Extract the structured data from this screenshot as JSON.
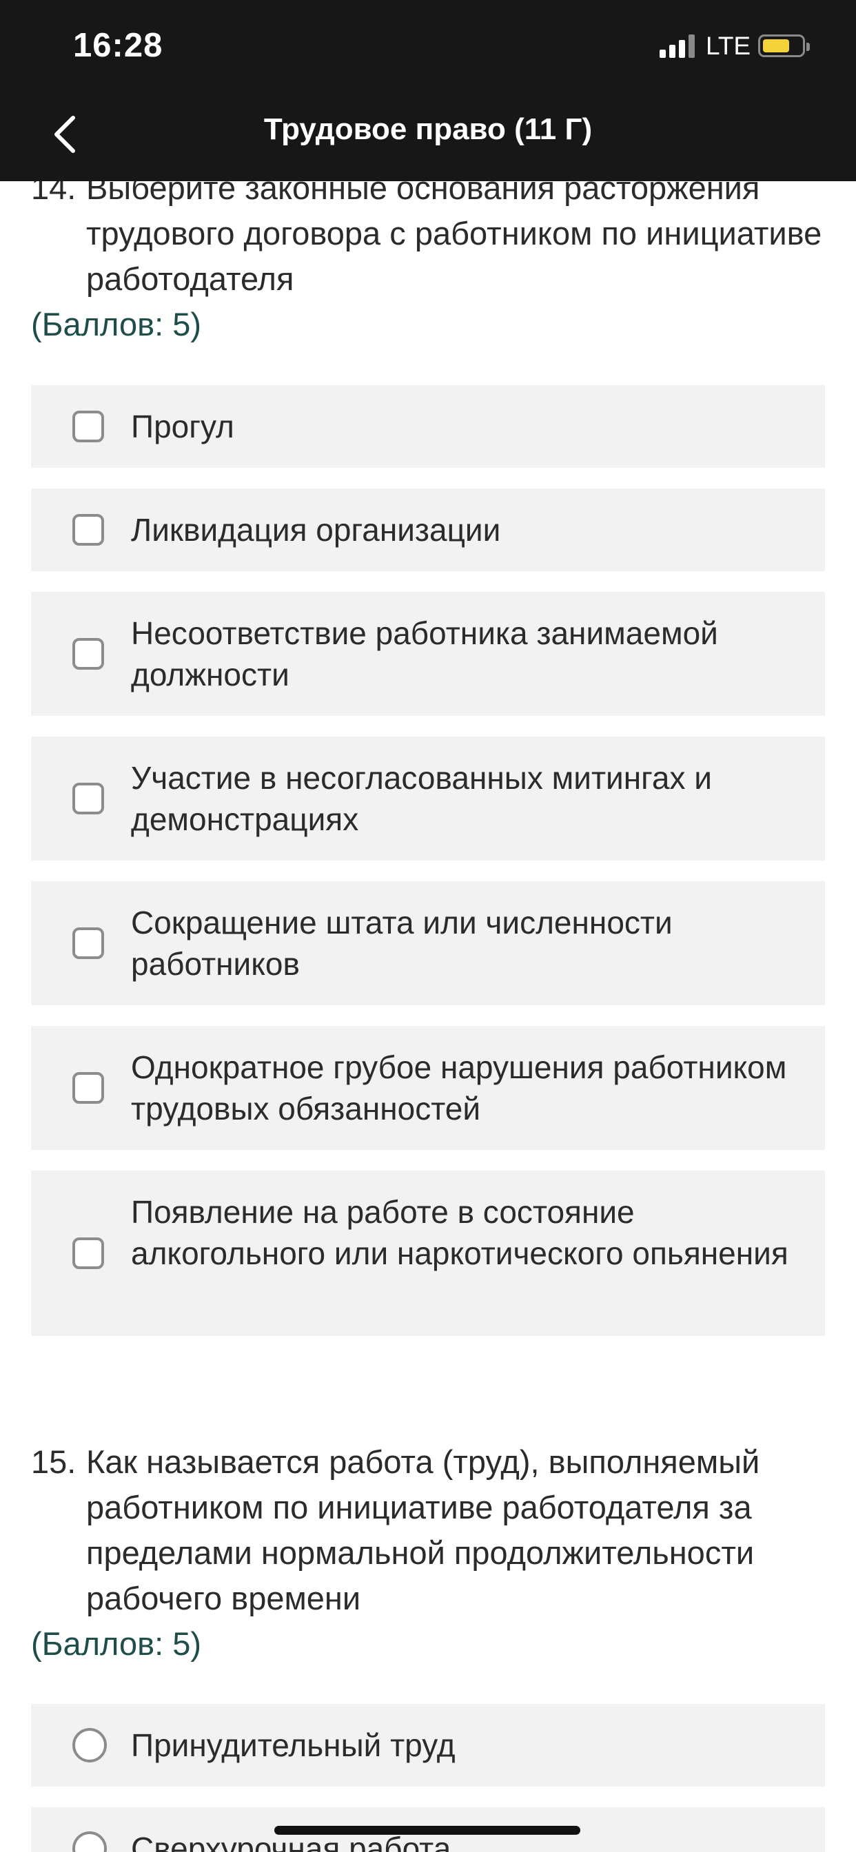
{
  "status_bar": {
    "time": "16:28",
    "network": "LTE",
    "battery_level": 0.6,
    "battery_color": "#f4d33a"
  },
  "nav": {
    "back_icon": "chevron-left-icon",
    "title": "Трудовое право (11  Г)"
  },
  "questions": [
    {
      "number": "14.",
      "text": "Выберите законные основания расторжения трудового договора с работником по инициативе работодателя",
      "points": "(Баллов: 5)",
      "type": "checkbox",
      "options": [
        {
          "label": "Прогул"
        },
        {
          "label": "Ликвидация организации"
        },
        {
          "label": "Несоответствие работника занимаемой должности"
        },
        {
          "label": "Участие в несогласованных митингах и демонстрациях"
        },
        {
          "label": "Сокращение штата или численности работников"
        },
        {
          "label": "Однократное грубое нарушения работником трудовых обязанностей"
        },
        {
          "label": "Появление на работе в состояние алкогольного или наркотического опьянения"
        }
      ]
    },
    {
      "number": "15.",
      "text": "Как называется работа (труд), выполняемый работником по инициативе работодателя за пределами нормальной продолжительности рабочего времени",
      "points": "(Баллов: 5)",
      "type": "radio",
      "options": [
        {
          "label": "Принудительный труд"
        },
        {
          "label": "Сверхурочная работа"
        }
      ]
    }
  ]
}
